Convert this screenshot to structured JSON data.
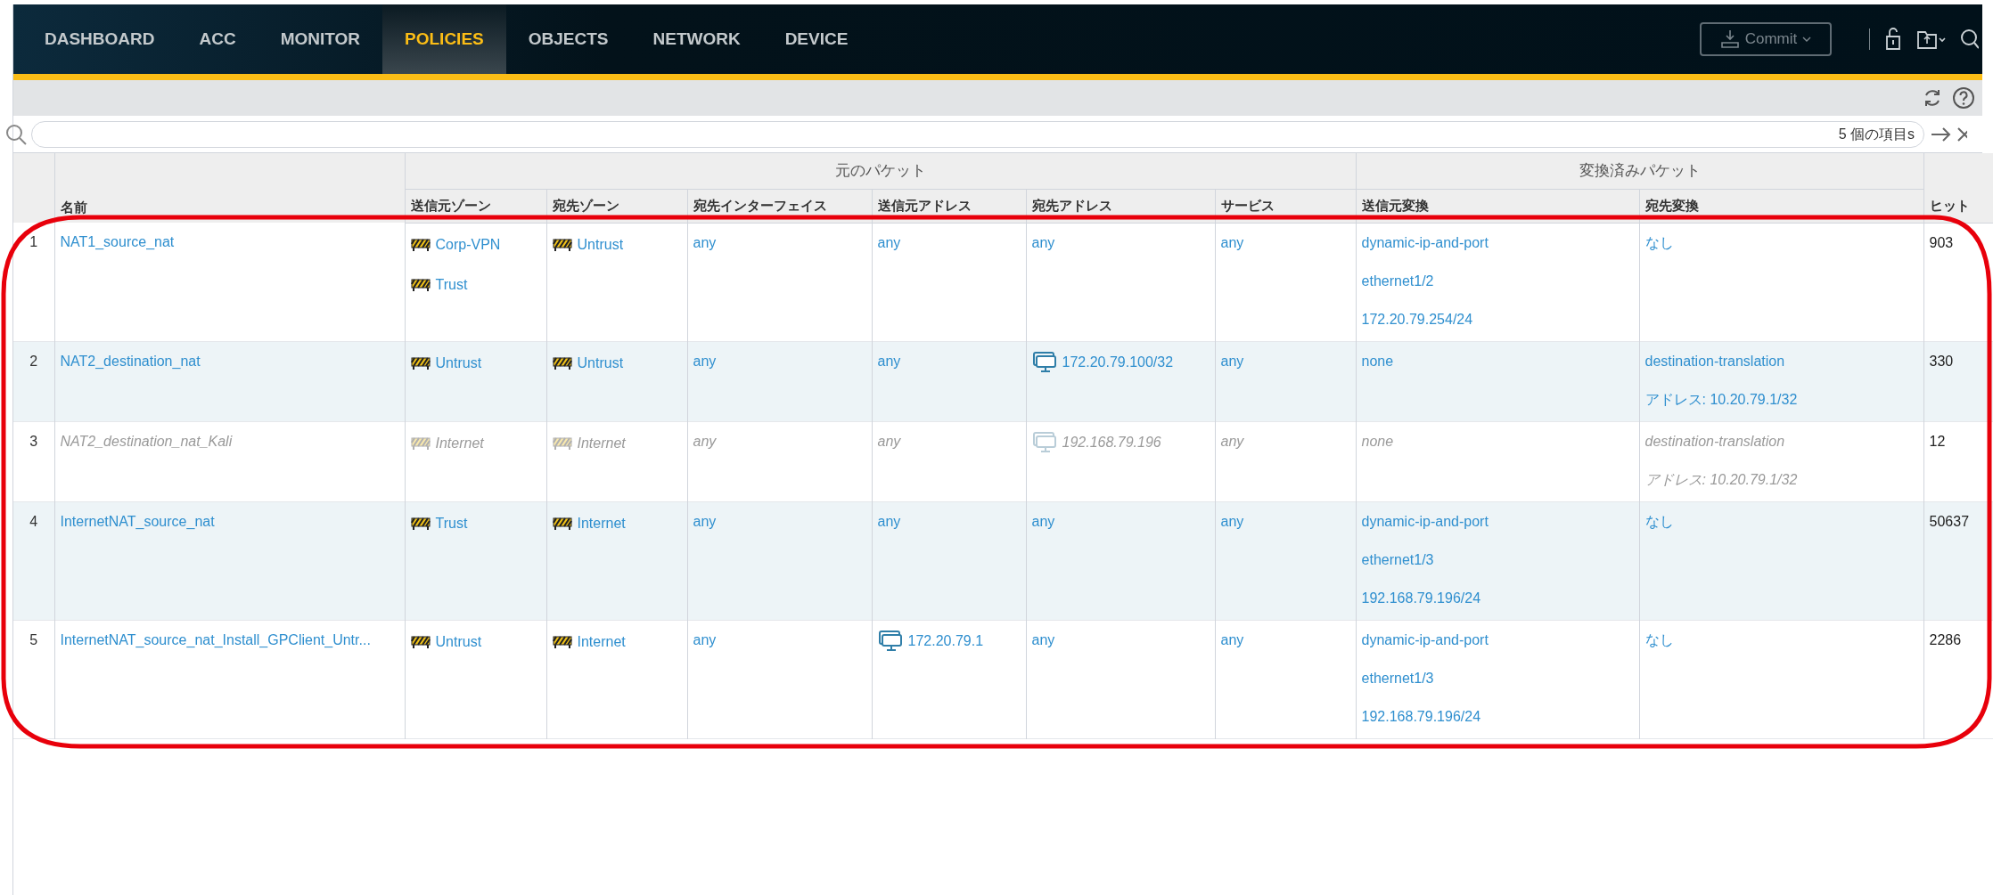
{
  "nav": {
    "tabs": [
      {
        "label": "DASHBOARD",
        "selected": false
      },
      {
        "label": "ACC",
        "selected": false
      },
      {
        "label": "MONITOR",
        "selected": false
      },
      {
        "label": "POLICIES",
        "selected": true
      },
      {
        "label": "OBJECTS",
        "selected": false
      },
      {
        "label": "NETWORK",
        "selected": false
      },
      {
        "label": "DEVICE",
        "selected": false
      }
    ],
    "commit_button": "Commit"
  },
  "search": {
    "count": "5 個の項目s"
  },
  "table": {
    "groups": [
      {
        "label": "元のパケット"
      },
      {
        "label": "変換済みパケット"
      }
    ],
    "name_column": "名前",
    "columns": [
      "送信元ゾーン",
      "宛先ゾーン",
      "宛先インターフェイス",
      "送信元アドレス",
      "宛先アドレス",
      "サービス",
      "送信元変換",
      "宛先変換",
      "ヒット"
    ],
    "rows": [
      {
        "number": "1",
        "name": "NAT1_source_nat",
        "disabled": false,
        "cells": [
          [
            {
              "kind": "zone",
              "text": "Corp-VPN"
            },
            {
              "kind": "zone",
              "text": "Trust"
            }
          ],
          [
            {
              "kind": "zone",
              "text": "Untrust"
            }
          ],
          [
            {
              "kind": "plain",
              "text": "any"
            }
          ],
          [
            {
              "kind": "plain",
              "text": "any"
            }
          ],
          [
            {
              "kind": "plain",
              "text": "any"
            }
          ],
          [
            {
              "kind": "plain",
              "text": "any"
            }
          ],
          [
            {
              "kind": "plain",
              "text": "dynamic-ip-and-port"
            },
            {
              "kind": "plain",
              "text": "ethernet1/2"
            },
            {
              "kind": "plain",
              "text": "172.20.79.254/24"
            }
          ],
          [
            {
              "kind": "plain",
              "text": "なし"
            }
          ]
        ],
        "hits": "903"
      },
      {
        "number": "2",
        "name": "NAT2_destination_nat",
        "disabled": false,
        "cells": [
          [
            {
              "kind": "zone",
              "text": "Untrust"
            }
          ],
          [
            {
              "kind": "zone",
              "text": "Untrust"
            }
          ],
          [
            {
              "kind": "plain",
              "text": "any"
            }
          ],
          [
            {
              "kind": "plain",
              "text": "any"
            }
          ],
          [
            {
              "kind": "address",
              "text": "172.20.79.100/32"
            }
          ],
          [
            {
              "kind": "plain",
              "text": "any"
            }
          ],
          [
            {
              "kind": "plain",
              "text": "none"
            }
          ],
          [
            {
              "kind": "plain",
              "text": "destination-translation"
            },
            {
              "kind": "plain",
              "text": "アドレス: 10.20.79.1/32"
            }
          ]
        ],
        "hits": "330"
      },
      {
        "number": "3",
        "name": "NAT2_destination_nat_Kali",
        "disabled": true,
        "cells": [
          [
            {
              "kind": "zone",
              "text": "Internet"
            }
          ],
          [
            {
              "kind": "zone",
              "text": "Internet"
            }
          ],
          [
            {
              "kind": "plain",
              "text": "any"
            }
          ],
          [
            {
              "kind": "plain",
              "text": "any"
            }
          ],
          [
            {
              "kind": "address",
              "text": "192.168.79.196"
            }
          ],
          [
            {
              "kind": "plain",
              "text": "any"
            }
          ],
          [
            {
              "kind": "plain",
              "text": "none"
            }
          ],
          [
            {
              "kind": "plain",
              "text": "destination-translation"
            },
            {
              "kind": "plain",
              "text": "アドレス: 10.20.79.1/32"
            }
          ]
        ],
        "hits": "12"
      },
      {
        "number": "4",
        "name": "InternetNAT_source_nat",
        "disabled": false,
        "cells": [
          [
            {
              "kind": "zone",
              "text": "Trust"
            }
          ],
          [
            {
              "kind": "zone",
              "text": "Internet"
            }
          ],
          [
            {
              "kind": "plain",
              "text": "any"
            }
          ],
          [
            {
              "kind": "plain",
              "text": "any"
            }
          ],
          [
            {
              "kind": "plain",
              "text": "any"
            }
          ],
          [
            {
              "kind": "plain",
              "text": "any"
            }
          ],
          [
            {
              "kind": "plain",
              "text": "dynamic-ip-and-port"
            },
            {
              "kind": "plain",
              "text": "ethernet1/3"
            },
            {
              "kind": "plain",
              "text": "192.168.79.196/24"
            }
          ],
          [
            {
              "kind": "plain",
              "text": "なし"
            }
          ]
        ],
        "hits": "50637"
      },
      {
        "number": "5",
        "name": "InternetNAT_source_nat_Install_GPClient_Untr...",
        "disabled": false,
        "cells": [
          [
            {
              "kind": "zone",
              "text": "Untrust"
            }
          ],
          [
            {
              "kind": "zone",
              "text": "Internet"
            }
          ],
          [
            {
              "kind": "plain",
              "text": "any"
            }
          ],
          [
            {
              "kind": "address",
              "text": "172.20.79.1"
            }
          ],
          [
            {
              "kind": "plain",
              "text": "any"
            }
          ],
          [
            {
              "kind": "plain",
              "text": "any"
            }
          ],
          [
            {
              "kind": "plain",
              "text": "dynamic-ip-and-port"
            },
            {
              "kind": "plain",
              "text": "ethernet1/3"
            },
            {
              "kind": "plain",
              "text": "192.168.79.196/24"
            }
          ],
          [
            {
              "kind": "plain",
              "text": "なし"
            }
          ]
        ],
        "hits": "2286"
      }
    ]
  },
  "highlight_outline": true
}
